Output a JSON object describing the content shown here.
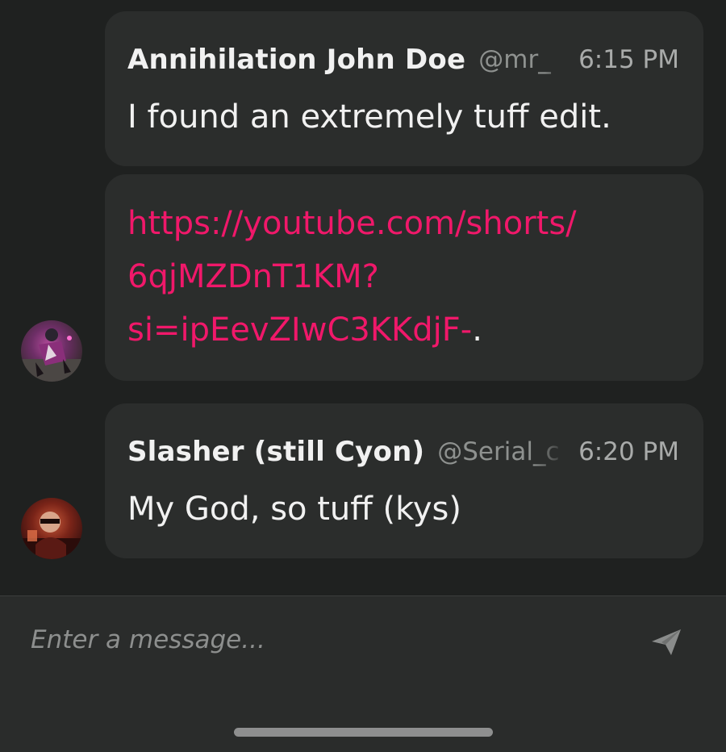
{
  "messages": [
    {
      "sender": "Annihilation John Doe",
      "handle": "@mr_",
      "time": "6:15 PM",
      "text": "I found an extremely tuff edit."
    },
    {
      "link_lines": [
        "https://youtube.com/shorts/",
        "6qjMZDnT1KM?",
        "si=ipEevZIwC3KKdjF-"
      ],
      "trailing": "."
    },
    {
      "sender": "Slasher (still Cyon)",
      "handle": "@Serial_c",
      "time": "6:20 PM",
      "text": "My God, so tuff (kys)"
    }
  ],
  "composer": {
    "placeholder": "Enter a message..."
  },
  "icons": {
    "send": "send-icon"
  },
  "colors": {
    "background": "#1f2120",
    "bubble": "#2b2d2c",
    "link": "#f0186a",
    "text": "#f1f1f1",
    "muted": "#8e918f"
  }
}
